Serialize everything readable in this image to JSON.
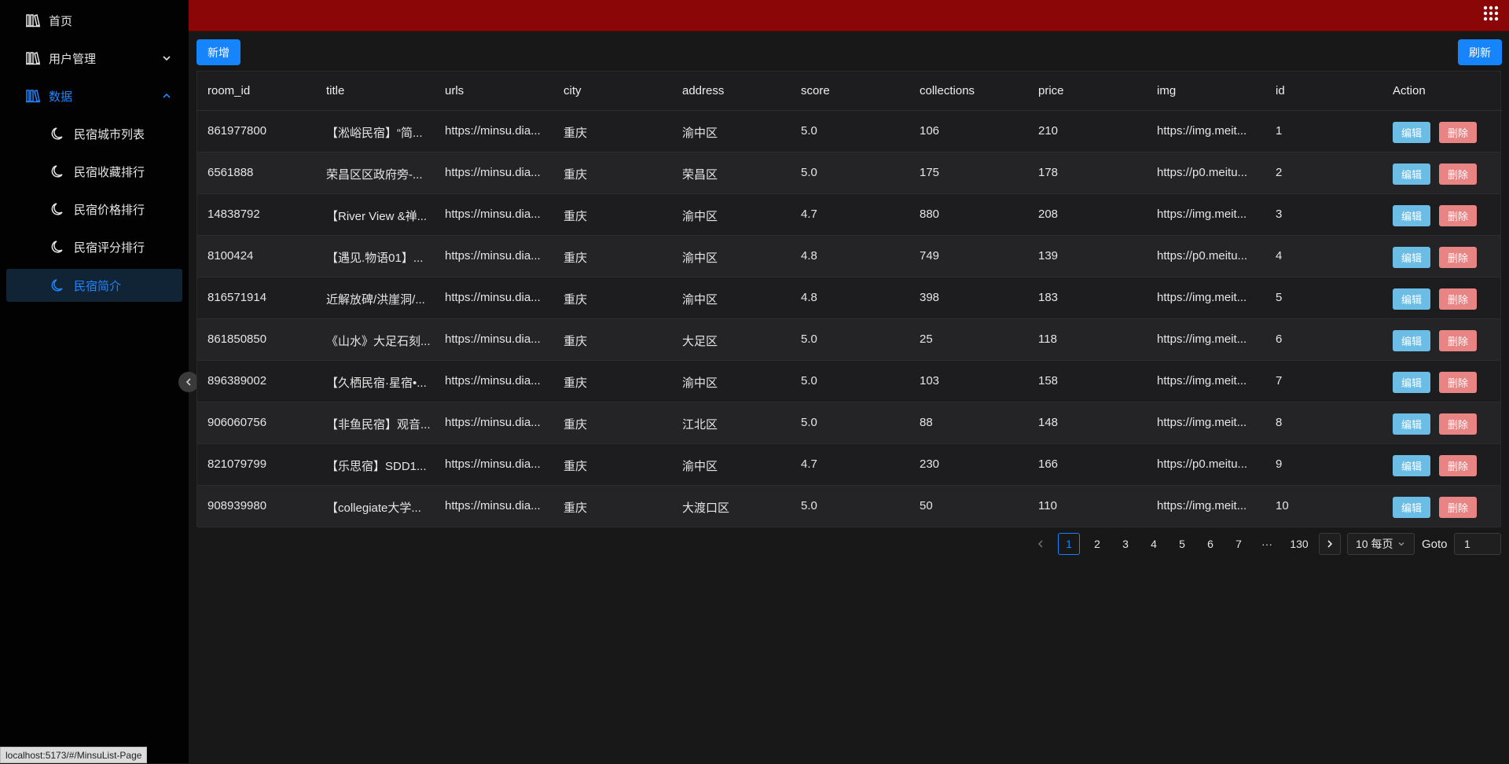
{
  "sidebar": {
    "items": [
      {
        "label": "首页",
        "icon": "library-icon"
      },
      {
        "label": "用户管理",
        "icon": "library-icon"
      },
      {
        "label": "数据",
        "icon": "library-icon"
      },
      {
        "label": "民宿城市列表",
        "icon": "moon-icon"
      },
      {
        "label": "民宿收藏排行",
        "icon": "moon-icon"
      },
      {
        "label": "民宿价格排行",
        "icon": "moon-icon"
      },
      {
        "label": "民宿评分排行",
        "icon": "moon-icon"
      },
      {
        "label": "民宿简介",
        "icon": "moon-icon"
      }
    ]
  },
  "toolbar": {
    "add_label": "新增",
    "refresh_label": "刷新"
  },
  "table": {
    "columns": [
      "room_id",
      "title",
      "urls",
      "city",
      "address",
      "score",
      "collections",
      "price",
      "img",
      "id",
      "Action"
    ],
    "rows": [
      {
        "room_id": "861977800",
        "title": "【淞峪民宿】“简...",
        "urls": "https://minsu.dia...",
        "city": "重庆",
        "address": "渝中区",
        "score": "5.0",
        "collections": "106",
        "price": "210",
        "img": "https://img.meit...",
        "id": "1"
      },
      {
        "room_id": "6561888",
        "title": "荣昌区区政府旁-...",
        "urls": "https://minsu.dia...",
        "city": "重庆",
        "address": "荣昌区",
        "score": "5.0",
        "collections": "175",
        "price": "178",
        "img": "https://p0.meitu...",
        "id": "2"
      },
      {
        "room_id": "14838792",
        "title": "【River View &禅...",
        "urls": "https://minsu.dia...",
        "city": "重庆",
        "address": "渝中区",
        "score": "4.7",
        "collections": "880",
        "price": "208",
        "img": "https://img.meit...",
        "id": "3"
      },
      {
        "room_id": "8100424",
        "title": "【遇见.物语01】...",
        "urls": "https://minsu.dia...",
        "city": "重庆",
        "address": "渝中区",
        "score": "4.8",
        "collections": "749",
        "price": "139",
        "img": "https://p0.meitu...",
        "id": "4"
      },
      {
        "room_id": "816571914",
        "title": "近解放碑/洪崖洞/...",
        "urls": "https://minsu.dia...",
        "city": "重庆",
        "address": "渝中区",
        "score": "4.8",
        "collections": "398",
        "price": "183",
        "img": "https://img.meit...",
        "id": "5"
      },
      {
        "room_id": "861850850",
        "title": "《山水》大足石刻...",
        "urls": "https://minsu.dia...",
        "city": "重庆",
        "address": "大足区",
        "score": "5.0",
        "collections": "25",
        "price": "118",
        "img": "https://img.meit...",
        "id": "6"
      },
      {
        "room_id": "896389002",
        "title": "【久栖民宿·星宿•...",
        "urls": "https://minsu.dia...",
        "city": "重庆",
        "address": "渝中区",
        "score": "5.0",
        "collections": "103",
        "price": "158",
        "img": "https://img.meit...",
        "id": "7"
      },
      {
        "room_id": "906060756",
        "title": "【非鱼民宿】观音...",
        "urls": "https://minsu.dia...",
        "city": "重庆",
        "address": "江北区",
        "score": "5.0",
        "collections": "88",
        "price": "148",
        "img": "https://img.meit...",
        "id": "8"
      },
      {
        "room_id": "821079799",
        "title": "【乐思宿】SDD1...",
        "urls": "https://minsu.dia...",
        "city": "重庆",
        "address": "渝中区",
        "score": "4.7",
        "collections": "230",
        "price": "166",
        "img": "https://p0.meitu...",
        "id": "9"
      },
      {
        "room_id": "908939980",
        "title": "【collegiate大学...",
        "urls": "https://minsu.dia...",
        "city": "重庆",
        "address": "大渡口区",
        "score": "5.0",
        "collections": "50",
        "price": "110",
        "img": "https://img.meit...",
        "id": "10"
      }
    ],
    "edit_label": "编辑",
    "delete_label": "删除"
  },
  "pagination": {
    "pages": [
      "1",
      "2",
      "3",
      "4",
      "5",
      "6",
      "7",
      "···",
      "130"
    ],
    "current": "1",
    "page_size": "10 每页",
    "goto_label": "Goto",
    "goto_value": "1"
  },
  "status_url": "localhost:5173/#/MinsuList-Page",
  "colors": {
    "topbar": "#8b0707",
    "primary": "#1684fc",
    "edit": "#6bbde6",
    "delete": "#e88484",
    "active_menu": "#1f85ff"
  }
}
